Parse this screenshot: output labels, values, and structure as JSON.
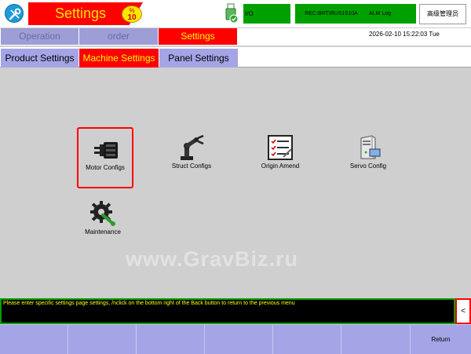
{
  "header": {
    "title": "Settings",
    "speed": {
      "symbol": "%",
      "value": "10"
    },
    "io_label": "I/O",
    "rec_label": "REC:BRTIRUS1510A",
    "alm_label": "ALM Log",
    "user_label": "高级管理员"
  },
  "nav": {
    "tabs": [
      {
        "label": "Operation"
      },
      {
        "label": "order"
      },
      {
        "label": "Settings"
      }
    ],
    "datetime": "2026-02-10  15:22:03  Tue"
  },
  "subtabs": [
    {
      "label": "Product Settings"
    },
    {
      "label": "Machine Settings"
    },
    {
      "label": "Panel Settings"
    }
  ],
  "tiles": [
    {
      "label": "Motor Configs",
      "icon": "motor-icon"
    },
    {
      "label": "Struct Configs",
      "icon": "robot-arm-icon"
    },
    {
      "label": "Origin Amend",
      "icon": "checklist-icon"
    },
    {
      "label": "Servo Config",
      "icon": "server-icon"
    },
    {
      "label": "Maintenance",
      "icon": "gear-wrench-icon"
    }
  ],
  "watermark": "www.GravBiz.ru",
  "message": "Please enter specific settings page settings, /nclick on the bottom right of the Back button to return to the previous menu",
  "back_label": "<",
  "bottom_buttons": [
    "",
    "",
    "",
    "",
    "",
    "Return"
  ],
  "colors": {
    "accent": "#ff0000",
    "highlight_text": "#ffff00",
    "tab_bg": "#a4a4e6",
    "status_green": "#00a000"
  }
}
